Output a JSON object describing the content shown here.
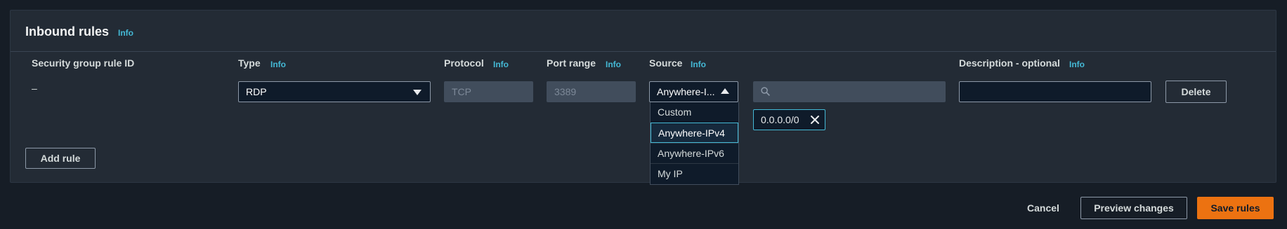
{
  "panel": {
    "title": "Inbound rules",
    "info": "Info"
  },
  "columns": {
    "rule_id": "Security group rule ID",
    "type": "Type",
    "type_info": "Info",
    "protocol": "Protocol",
    "protocol_info": "Info",
    "port_range": "Port range",
    "port_range_info": "Info",
    "source": "Source",
    "source_info": "Info",
    "description": "Description - optional",
    "description_info": "Info"
  },
  "row": {
    "rule_id": "–",
    "type_value": "RDP",
    "protocol_value": "TCP",
    "port_value": "3389",
    "source_value": "Anywhere-I...",
    "source_search_value": "",
    "cidr_token": "0.0.0.0/0",
    "description_value": "",
    "delete_label": "Delete"
  },
  "source_options": [
    "Custom",
    "Anywhere-IPv4",
    "Anywhere-IPv6",
    "My IP"
  ],
  "source_selected_option": "Anywhere-IPv4",
  "add_rule_label": "Add rule",
  "footer": {
    "cancel_label": "Cancel",
    "preview_label": "Preview changes",
    "save_label": "Save rules"
  },
  "colors": {
    "background": "#161d26",
    "panel": "#232b35",
    "link": "#44b9d6",
    "primary": "#ec7211"
  },
  "icons": [
    "chevron-down-icon",
    "chevron-up-icon",
    "search-icon",
    "close-icon"
  ]
}
